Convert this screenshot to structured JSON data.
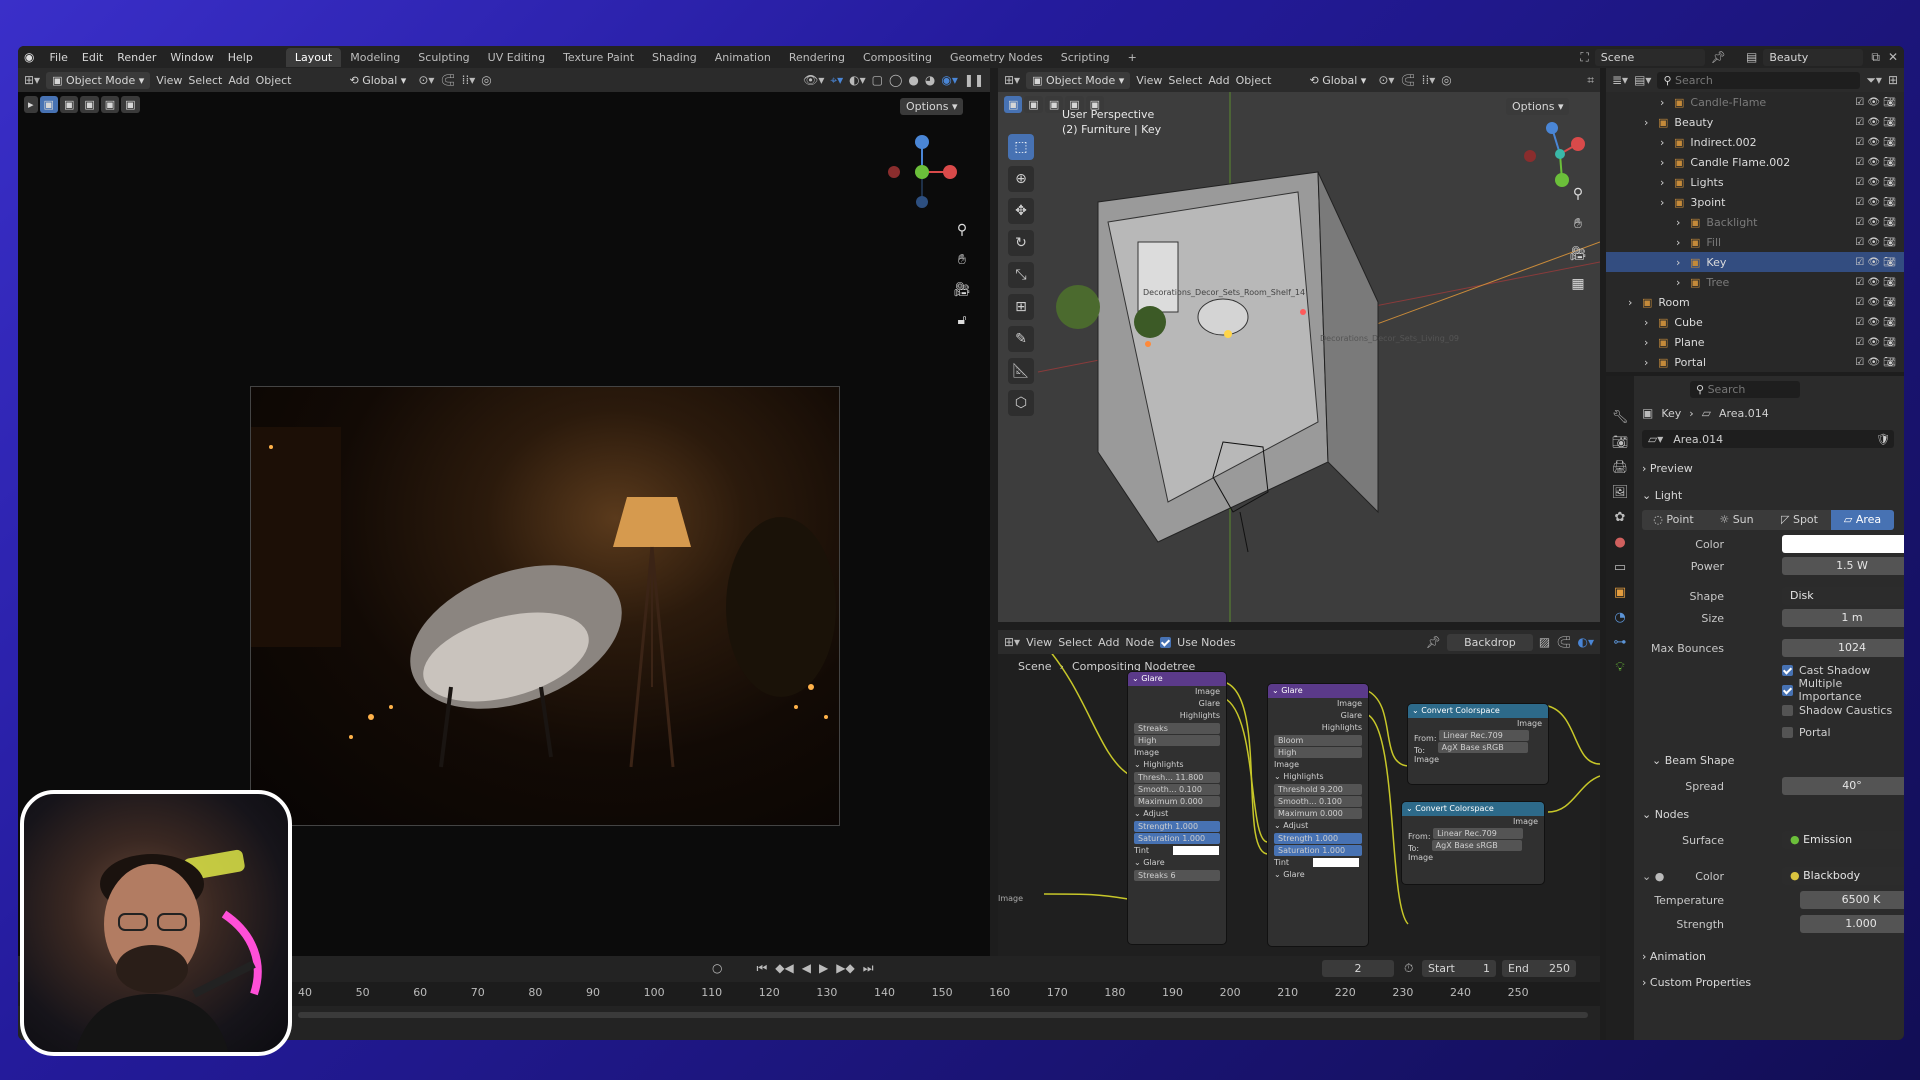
{
  "menu": {
    "items": [
      "File",
      "Edit",
      "Render",
      "Window",
      "Help"
    ]
  },
  "workspaces": {
    "tabs": [
      "Layout",
      "Modeling",
      "Sculpting",
      "UV Editing",
      "Texture Paint",
      "Shading",
      "Animation",
      "Rendering",
      "Compositing",
      "Geometry Nodes",
      "Scripting"
    ],
    "active": "Layout"
  },
  "top_right": {
    "scene": "Scene",
    "view_layer": "Beauty"
  },
  "left_viewport": {
    "mode": "Object Mode",
    "menus": [
      "View",
      "Select",
      "Add",
      "Object"
    ],
    "orientation": "Global",
    "options_label": "Options"
  },
  "right_viewport": {
    "mode": "Object Mode",
    "menus": [
      "View",
      "Select",
      "Add",
      "Object"
    ],
    "orientation": "Global",
    "options_label": "Options",
    "view_name": "User Perspective",
    "active_collection": "(2) Furniture | Key",
    "label_a": "Decorations_Decor_Sets_Room_Shelf_14",
    "label_b": "Decorations_Decor_Sets_Living_09"
  },
  "outliner": {
    "search_placeholder": "Search",
    "rows": [
      {
        "label": "Candle-Flame",
        "indent": 3,
        "selected": false,
        "dim": true
      },
      {
        "label": "Beauty",
        "indent": 2,
        "selected": false,
        "dim": false
      },
      {
        "label": "Indirect.002",
        "indent": 3,
        "selected": false,
        "dim": false
      },
      {
        "label": "Candle Flame.002",
        "indent": 3,
        "selected": false,
        "dim": false
      },
      {
        "label": "Lights",
        "indent": 3,
        "selected": false,
        "dim": false
      },
      {
        "label": "3point",
        "indent": 3,
        "selected": false,
        "dim": false
      },
      {
        "label": "Backlight",
        "indent": 4,
        "selected": false,
        "dim": true
      },
      {
        "label": "Fill",
        "indent": 4,
        "selected": false,
        "dim": true
      },
      {
        "label": "Key",
        "indent": 4,
        "selected": true,
        "dim": false
      },
      {
        "label": "Tree",
        "indent": 4,
        "selected": false,
        "dim": true
      },
      {
        "label": "Room",
        "indent": 1,
        "selected": false,
        "dim": false
      },
      {
        "label": "Cube",
        "indent": 2,
        "selected": false,
        "dim": false
      },
      {
        "label": "Plane",
        "indent": 2,
        "selected": false,
        "dim": false
      },
      {
        "label": "Portal",
        "indent": 2,
        "selected": false,
        "dim": false
      }
    ]
  },
  "properties": {
    "search_placeholder": "Search",
    "breadcrumb_object": "Key",
    "breadcrumb_data": "Area.014",
    "datablock": "Area.014",
    "preview_label": "Preview",
    "light_label": "Light",
    "light_types": [
      "Point",
      "Sun",
      "Spot",
      "Area"
    ],
    "active_light_type": "Area",
    "color_label": "Color",
    "power_label": "Power",
    "power_value": "1.5 W",
    "shape_label": "Shape",
    "shape_value": "Disk",
    "size_label": "Size",
    "size_value": "1 m",
    "bounces_label": "Max Bounces",
    "bounces_value": "1024",
    "cast_shadow": "Cast Shadow",
    "multiple_importance": "Multiple Importance",
    "shadow_caustics": "Shadow Caustics",
    "portal": "Portal",
    "beam_shape_label": "Beam Shape",
    "spread_label": "Spread",
    "spread_value": "40°",
    "nodes_label": "Nodes",
    "surface_label": "Surface",
    "surface_value": "Emission",
    "node_color_label": "Color",
    "node_color_value": "Blackbody",
    "temperature_label": "Temperature",
    "temperature_value": "6500 K",
    "strength_label": "Strength",
    "strength_value": "1.000",
    "animation_label": "Animation",
    "custom_props_label": "Custom Properties"
  },
  "compositor": {
    "menus": [
      "View",
      "Select",
      "Add",
      "Node"
    ],
    "use_nodes_label": "Use Nodes",
    "backdrop_label": "Backdrop",
    "breadcrumb_scene": "Scene",
    "breadcrumb_tree": "Compositing Nodetree",
    "image_label": "Image",
    "glare1": {
      "title": "Glare",
      "outputs": [
        "Image",
        "Glare",
        "Highlights"
      ],
      "type": "Streaks",
      "quality": "High",
      "highlights": "Highlights",
      "input": "Image",
      "threshold": "Thresh... 11.800",
      "smooth": "Smooth... 0.100",
      "maximum": "Maximum 0.000",
      "adjust": "Adjust",
      "strength": "Strength 1.000",
      "saturation": "Saturation 1.000",
      "tint": "Tint",
      "footer": "Glare",
      "streaks": "Streaks 6"
    },
    "glare2": {
      "title": "Glare",
      "outputs": [
        "Image",
        "Glare",
        "Highlights"
      ],
      "type": "Bloom",
      "quality": "High",
      "input": "Image",
      "highlights": "Highlights",
      "threshold": "Threshold 9.200",
      "smooth": "Smooth... 0.100",
      "maximum": "Maximum 0.000",
      "adjust": "Adjust",
      "strength": "Strength 1.000",
      "saturation": "Saturation 1.000",
      "tint": "Tint",
      "footer": "Glare"
    },
    "convert1": {
      "title": "Convert Colorspace",
      "output": "Image",
      "from_label": "From:",
      "from": "Linear Rec.709",
      "to_label": "To:",
      "to": "AgX Base sRGB",
      "input": "Image"
    },
    "convert2": {
      "title": "Convert Colorspace",
      "output": "Image",
      "from_label": "From:",
      "from": "Linear Rec.709",
      "to_label": "To:",
      "to": "AgX Base sRGB",
      "input": "Image"
    }
  },
  "timeline": {
    "current_frame": "2",
    "start_label": "Start",
    "start": "1",
    "end_label": "End",
    "end": "250",
    "ticks": [
      "40",
      "50",
      "60",
      "70",
      "80",
      "90",
      "100",
      "110",
      "120",
      "130",
      "140",
      "150",
      "160",
      "170",
      "180",
      "190",
      "200",
      "210",
      "220",
      "230",
      "240",
      "250"
    ]
  },
  "colors": {
    "accent": "#4772b3",
    "selection": "#334d80",
    "node_socket": "#c7c729"
  }
}
